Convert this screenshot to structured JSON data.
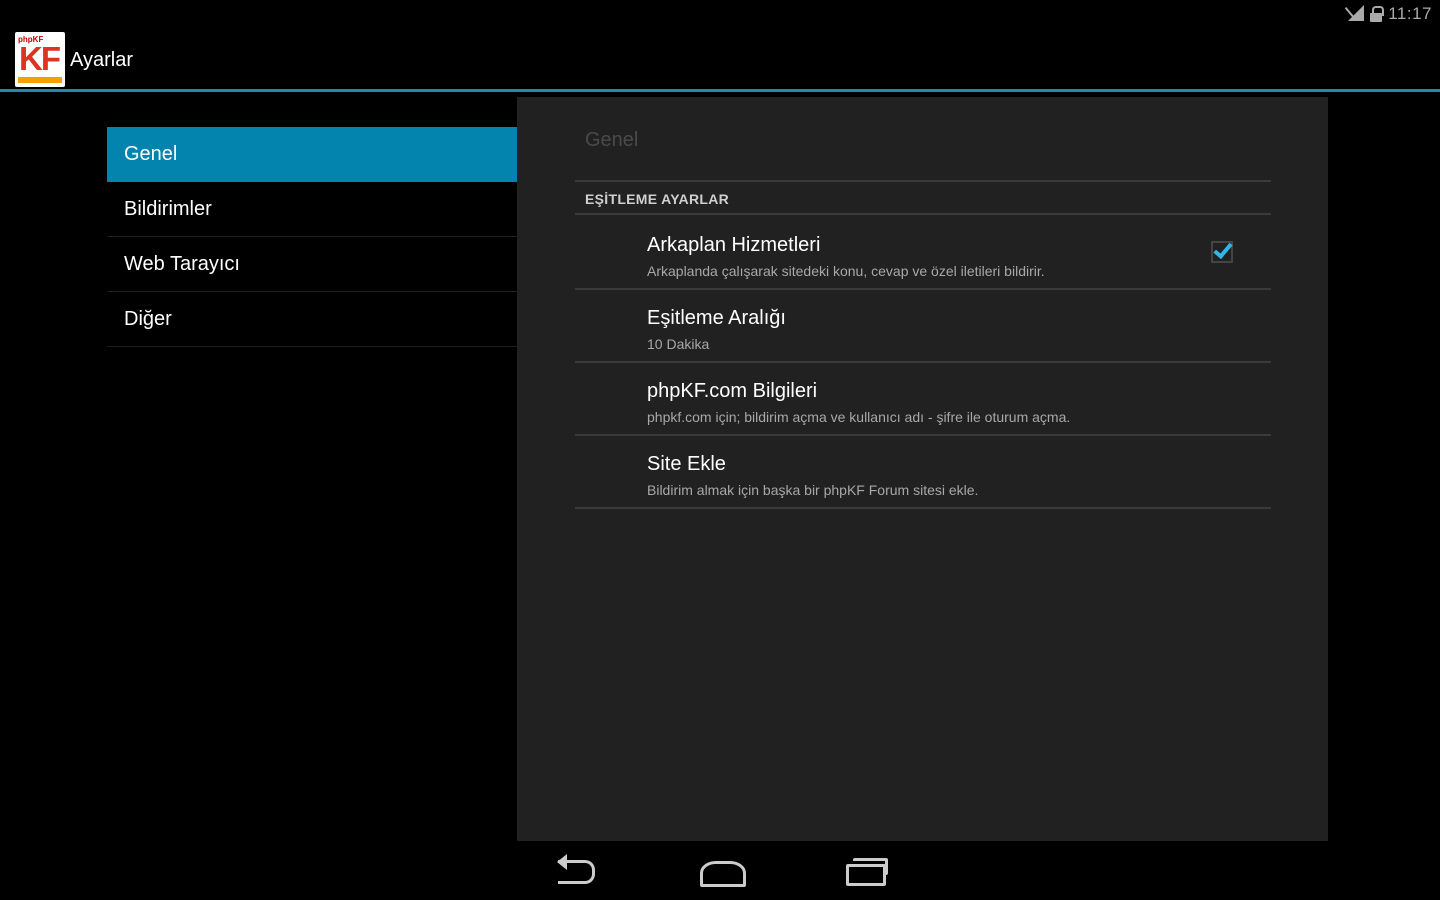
{
  "status_bar": {
    "time": "11:17",
    "icons": [
      "signal-icon",
      "lock-icon"
    ]
  },
  "action_bar": {
    "logo": {
      "top_text": "phpKF",
      "letters": "KF"
    },
    "title": "Ayarlar"
  },
  "headers": [
    {
      "label": "Genel",
      "selected": true
    },
    {
      "label": "Bildirimler",
      "selected": false
    },
    {
      "label": "Web Tarayıcı",
      "selected": false
    },
    {
      "label": "Diğer",
      "selected": false
    }
  ],
  "pane": {
    "breadcrumb": "Genel",
    "category": "EŞİTLEME AYARLAR",
    "preferences": [
      {
        "title": "Arkaplan Hizmetleri",
        "summary": "Arkaplanda çalışarak sitedeki konu, cevap ve özel iletileri bildirir.",
        "checked": true
      },
      {
        "title": "Eşitleme Aralığı",
        "summary": "10 Dakika"
      },
      {
        "title": "phpKF.com Bilgileri",
        "summary": "phpkf.com için; bildirim açma ve kullanıcı adı - şifre ile oturum açma."
      },
      {
        "title": "Site Ekle",
        "summary": "Bildirim almak için başka bir phpKF Forum sitesi ekle."
      }
    ]
  },
  "nav_bar": {
    "buttons": [
      "back-icon",
      "home-icon",
      "recent-apps-icon"
    ]
  },
  "colors": {
    "accent": "#33b5e5",
    "selected_header": "#0284ae",
    "pane_background": "#212121"
  }
}
